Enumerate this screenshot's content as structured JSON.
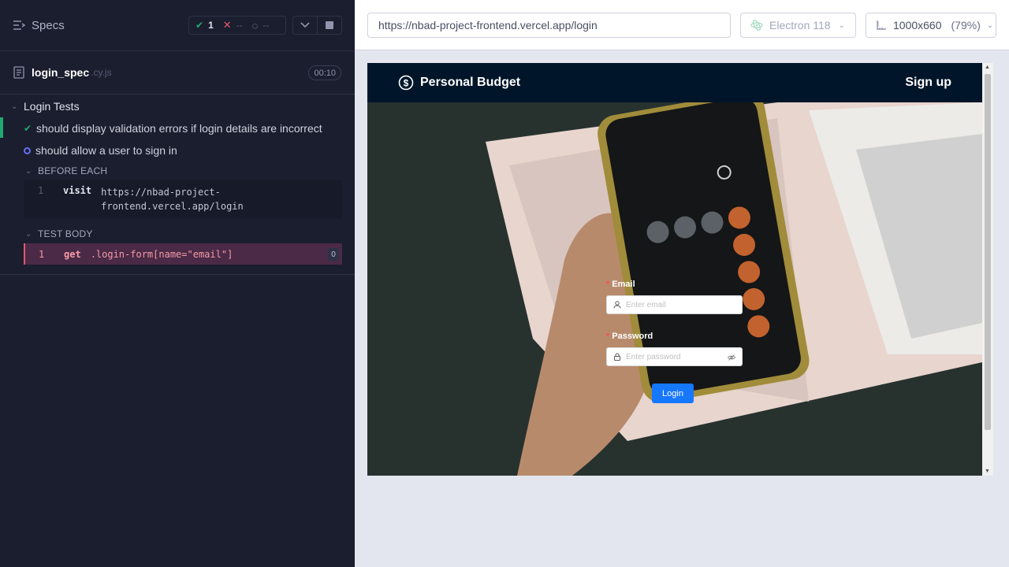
{
  "reporter": {
    "specs_label": "Specs",
    "stats": {
      "passed": "1",
      "failed": "--",
      "pending": "--"
    },
    "spec": {
      "name": "login_spec",
      "ext": ".cy.js",
      "duration": "00:10"
    },
    "suite": {
      "title": "Login Tests",
      "tests": [
        {
          "title": "should display validation errors if login details are incorrect",
          "state": "passed"
        },
        {
          "title": "should allow a user to sign in",
          "state": "running"
        }
      ],
      "before_each": {
        "title": "BEFORE EACH",
        "commands": [
          {
            "num": "1",
            "name": "visit",
            "message": "https://nbad-project-frontend.vercel.app/login"
          }
        ]
      },
      "test_body": {
        "title": "TEST BODY",
        "commands": [
          {
            "num": "1",
            "name": "get",
            "message": ".login-form[name=\"email\"]",
            "count": "0"
          }
        ]
      }
    }
  },
  "topbar": {
    "url": "https://nbad-project-frontend.vercel.app/login",
    "browser": "Electron 118",
    "viewport": "1000x660",
    "scale": "(79%)"
  },
  "app": {
    "brand": "Personal Budget",
    "nav_link": "Sign up",
    "email_label": "Email",
    "email_placeholder": "Enter email",
    "password_label": "Password",
    "password_placeholder": "Enter password",
    "login_button": "Login",
    "required_mark": "*"
  },
  "colors": {
    "reporter_bg": "#1b1e2e",
    "pass": "#1fa971",
    "fail": "#e45770",
    "running": "#6470f3",
    "nav_bg": "#001529",
    "primary": "#1677ff"
  }
}
